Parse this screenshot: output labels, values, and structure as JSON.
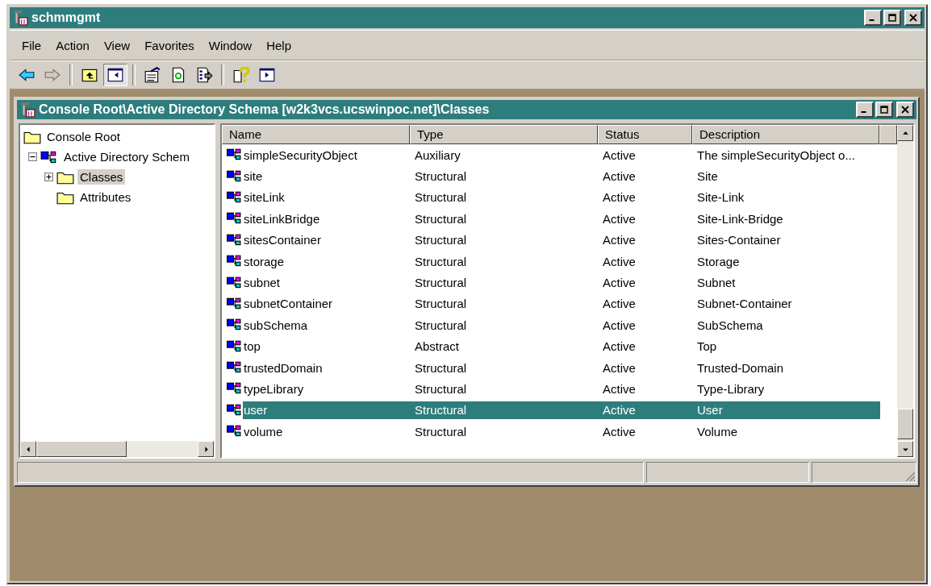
{
  "window": {
    "title": "schmmgmt"
  },
  "menu": [
    "File",
    "Action",
    "View",
    "Favorites",
    "Window",
    "Help"
  ],
  "toolbar": [
    [
      {
        "kind": "back",
        "disabled": false,
        "pressed": false
      },
      {
        "kind": "forward",
        "disabled": true,
        "pressed": false
      }
    ],
    [
      {
        "kind": "up",
        "disabled": false,
        "pressed": false
      },
      {
        "kind": "tree",
        "disabled": false,
        "pressed": true
      }
    ],
    [
      {
        "kind": "properties",
        "disabled": false,
        "pressed": false
      },
      {
        "kind": "refresh",
        "disabled": false,
        "pressed": false
      },
      {
        "kind": "export",
        "disabled": false,
        "pressed": false
      }
    ],
    [
      {
        "kind": "help",
        "disabled": false,
        "pressed": false
      },
      {
        "kind": "pane",
        "disabled": false,
        "pressed": false
      }
    ]
  ],
  "console": {
    "title": "Console Root\\Active Directory Schema [w2k3vcs.ucswinpoc.net]\\Classes",
    "tree": [
      {
        "label": "Console Root",
        "kind": "folder",
        "selected": false,
        "children": [
          {
            "label": "Active Directory Schem",
            "kind": "schema",
            "selected": false,
            "expanded": true,
            "children": [
              {
                "label": "Classes",
                "kind": "folder",
                "selected": true,
                "expanded": false
              },
              {
                "label": "Attributes",
                "kind": "folder",
                "selected": false
              }
            ]
          }
        ]
      }
    ],
    "table": {
      "columns": [
        "Name",
        "Type",
        "Status",
        "Description"
      ],
      "rows": [
        {
          "name": "simpleSecurityObject",
          "type": "Auxiliary",
          "status": "Active",
          "description": "The simpleSecurityObject o...",
          "selected": false
        },
        {
          "name": "site",
          "type": "Structural",
          "status": "Active",
          "description": "Site",
          "selected": false
        },
        {
          "name": "siteLink",
          "type": "Structural",
          "status": "Active",
          "description": "Site-Link",
          "selected": false
        },
        {
          "name": "siteLinkBridge",
          "type": "Structural",
          "status": "Active",
          "description": "Site-Link-Bridge",
          "selected": false
        },
        {
          "name": "sitesContainer",
          "type": "Structural",
          "status": "Active",
          "description": "Sites-Container",
          "selected": false
        },
        {
          "name": "storage",
          "type": "Structural",
          "status": "Active",
          "description": "Storage",
          "selected": false
        },
        {
          "name": "subnet",
          "type": "Structural",
          "status": "Active",
          "description": "Subnet",
          "selected": false
        },
        {
          "name": "subnetContainer",
          "type": "Structural",
          "status": "Active",
          "description": "Subnet-Container",
          "selected": false
        },
        {
          "name": "subSchema",
          "type": "Structural",
          "status": "Active",
          "description": "SubSchema",
          "selected": false
        },
        {
          "name": "top",
          "type": "Abstract",
          "status": "Active",
          "description": "Top",
          "selected": false
        },
        {
          "name": "trustedDomain",
          "type": "Structural",
          "status": "Active",
          "description": "Trusted-Domain",
          "selected": false
        },
        {
          "name": "typeLibrary",
          "type": "Structural",
          "status": "Active",
          "description": "Type-Library",
          "selected": false
        },
        {
          "name": "user",
          "type": "Structural",
          "status": "Active",
          "description": "User",
          "selected": true
        },
        {
          "name": "volume",
          "type": "Structural",
          "status": "Active",
          "description": "Volume",
          "selected": false
        }
      ]
    }
  }
}
